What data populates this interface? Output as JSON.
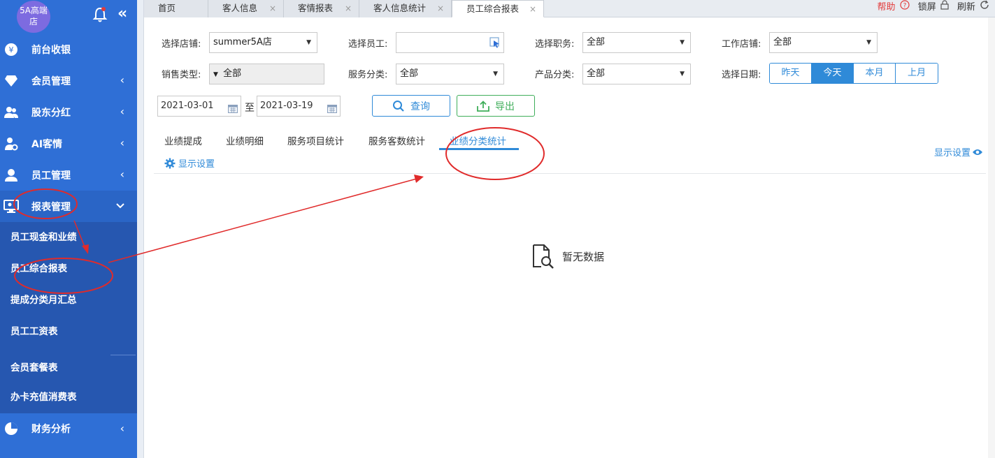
{
  "sidebar": {
    "store_name": "5A高端店",
    "collapse_glyph": "«",
    "menu": [
      {
        "label": "前台收银",
        "icon": "yen-icon"
      },
      {
        "label": "会员管理",
        "icon": "diamond-icon",
        "arrow": "‹"
      },
      {
        "label": "股东分红",
        "icon": "users-icon",
        "arrow": "‹"
      },
      {
        "label": "AI客情",
        "icon": "user-gear-icon",
        "arrow": "‹"
      },
      {
        "label": "员工管理",
        "icon": "user-icon",
        "arrow": "‹"
      },
      {
        "label": "报表管理",
        "icon": "monitor-icon",
        "arrow": "⌄"
      }
    ],
    "sub_items": [
      "员工现金和业绩",
      "员工综合报表",
      "提成分类月汇总",
      "员工工资表",
      "会员套餐表",
      "办卡充值消费表"
    ],
    "finance": {
      "label": "财务分析",
      "icon": "pie-icon",
      "arrow": "‹"
    }
  },
  "tabs": [
    {
      "label": "首页"
    },
    {
      "label": "客人信息",
      "close": "×"
    },
    {
      "label": "客情报表",
      "close": "×"
    },
    {
      "label": "客人信息统计",
      "close": "×"
    },
    {
      "label": "员工综合报表",
      "close": "×"
    }
  ],
  "topright": {
    "help": "帮助",
    "lock": "锁屏",
    "refresh": "刷新"
  },
  "filters": {
    "store_label": "选择店铺:",
    "store_value": "summer5A店",
    "staff_label": "选择员工:",
    "staff_value": "",
    "position_label": "选择职务:",
    "position_value": "全部",
    "workshop_label": "工作店铺:",
    "workshop_value": "全部",
    "sale_type_label": "销售类型:",
    "sale_type_value": "全部",
    "service_label": "服务分类:",
    "service_value": "全部",
    "product_label": "产品分类:",
    "product_value": "全部",
    "date_label": "选择日期:",
    "date_buttons": [
      "昨天",
      "今天",
      "本月",
      "上月"
    ],
    "date_active": "今天",
    "date_from": "2021-03-01",
    "date_to_sep": "至",
    "date_to": "2021-03-19",
    "query": "查询",
    "export": "导出"
  },
  "report_tabs": [
    "业绩提成",
    "业绩明细",
    "服务项目统计",
    "服务客数统计",
    "业绩分类统计"
  ],
  "active_report_tab": "业绩分类统计",
  "display_settings": "显示设置",
  "display_settings_right": "显示设置",
  "empty_text": "暂无数据",
  "colors": {
    "sidebar": "#2f6fd6",
    "accent": "#2f8ad8",
    "export": "#3fae5a",
    "annotation": "#e02b2b"
  }
}
